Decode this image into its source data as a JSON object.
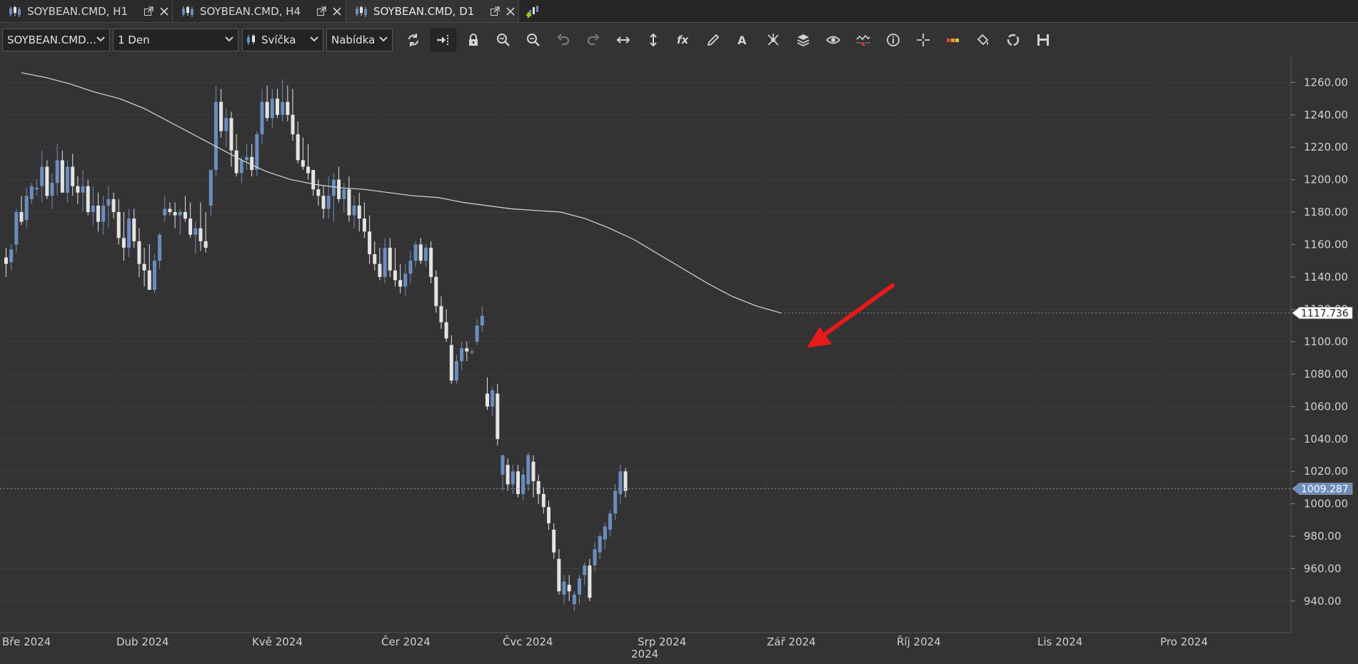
{
  "tabs": [
    {
      "label": "SOYBEAN.CMD, H1",
      "active": false
    },
    {
      "label": "SOYBEAN.CMD, H4",
      "active": false
    },
    {
      "label": "SOYBEAN.CMD, D1",
      "active": true
    }
  ],
  "toolbar": {
    "symbol": "SOYBEAN.CMD...",
    "timeframe": "1 Den",
    "chart_type": "Svíčka",
    "price_side": "Nabídka",
    "icons": [
      "refresh-icon",
      "autoscroll-icon",
      "lock-icon",
      "zoom-in-icon",
      "zoom-out-icon",
      "undo-icon",
      "redo-icon",
      "horizontal-scale-icon",
      "vertical-scale-icon",
      "indicators-fx-icon",
      "draw-pencil-icon",
      "text-tool-icon",
      "hub-icon",
      "layers-icon",
      "eye-icon",
      "signal-icon",
      "info-icon",
      "crosshair-icon",
      "color-bar-icon",
      "paint-bucket-icon",
      "sync-icon",
      "save-icon"
    ]
  },
  "chart_data": {
    "type": "candlestick",
    "symbol": "SOYBEAN.CMD",
    "timeframe": "D1",
    "ylim": [
      932,
      1269
    ],
    "y_ticks": [
      "1260.00",
      "1240.00",
      "1220.00",
      "1200.00",
      "1180.00",
      "1160.00",
      "1140.00",
      "1120.00",
      "1100.00",
      "1080.00",
      "1060.00",
      "1040.00",
      "1020.00",
      "1000.00",
      "980.00",
      "960.00",
      "940.00"
    ],
    "x_labels": [
      "Bře 2024",
      "Dub 2024",
      "Kvě 2024",
      "Čer 2024",
      "Čvc 2024",
      "Srp 2024",
      "Zář 2024",
      "Říj 2024",
      "Lis 2024",
      "Pro 2024"
    ],
    "year_label": "2024",
    "price_labels": {
      "moving_average": "1117.736",
      "current_price": "1009.287"
    },
    "colors": {
      "bull": "#6b8dbd",
      "bear": "#e4e4e4",
      "ma": "#d8d8d8",
      "arrow": "#e8191a",
      "current_label": "#6b8dbd"
    },
    "candles": [
      [
        1152,
        1158,
        1140,
        1148
      ],
      [
        1149,
        1160,
        1144,
        1157
      ],
      [
        1160,
        1182,
        1155,
        1180
      ],
      [
        1180,
        1190,
        1172,
        1174
      ],
      [
        1175,
        1195,
        1170,
        1190
      ],
      [
        1188,
        1198,
        1185,
        1196
      ],
      [
        1194,
        1200,
        1190,
        1195
      ],
      [
        1196,
        1218,
        1186,
        1208
      ],
      [
        1208,
        1212,
        1188,
        1190
      ],
      [
        1190,
        1204,
        1182,
        1198
      ],
      [
        1198,
        1222,
        1190,
        1212
      ],
      [
        1212,
        1218,
        1200,
        1192
      ],
      [
        1192,
        1212,
        1186,
        1208
      ],
      [
        1208,
        1216,
        1190,
        1196
      ],
      [
        1196,
        1202,
        1185,
        1192
      ],
      [
        1192,
        1206,
        1180,
        1196
      ],
      [
        1196,
        1200,
        1178,
        1180
      ],
      [
        1180,
        1196,
        1172,
        1184
      ],
      [
        1184,
        1192,
        1168,
        1174
      ],
      [
        1174,
        1190,
        1166,
        1184
      ],
      [
        1184,
        1196,
        1170,
        1188
      ],
      [
        1188,
        1192,
        1176,
        1180
      ],
      [
        1180,
        1188,
        1160,
        1164
      ],
      [
        1164,
        1180,
        1150,
        1158
      ],
      [
        1158,
        1182,
        1152,
        1176
      ],
      [
        1176,
        1182,
        1158,
        1162
      ],
      [
        1162,
        1170,
        1140,
        1148
      ],
      [
        1148,
        1158,
        1134,
        1144
      ],
      [
        1144,
        1160,
        1132,
        1132
      ],
      [
        1132,
        1154,
        1130,
        1150
      ],
      [
        1150,
        1167,
        1145,
        1166
      ],
      [
        1178,
        1190,
        1174,
        1182
      ],
      [
        1182,
        1186,
        1178,
        1180
      ],
      [
        1180,
        1186,
        1170,
        1178
      ],
      [
        1178,
        1182,
        1166,
        1180
      ],
      [
        1180,
        1190,
        1174,
        1176
      ],
      [
        1176,
        1186,
        1164,
        1166
      ],
      [
        1166,
        1174,
        1154,
        1170
      ],
      [
        1170,
        1186,
        1156,
        1162
      ],
      [
        1162,
        1180,
        1155,
        1158
      ],
      [
        1184,
        1206,
        1178,
        1206
      ],
      [
        1206,
        1258,
        1202,
        1248
      ],
      [
        1248,
        1256,
        1226,
        1230
      ],
      [
        1230,
        1244,
        1220,
        1238
      ],
      [
        1238,
        1242,
        1208,
        1218
      ],
      [
        1218,
        1228,
        1202,
        1204
      ],
      [
        1204,
        1214,
        1198,
        1212
      ],
      [
        1212,
        1222,
        1206,
        1214
      ],
      [
        1214,
        1222,
        1202,
        1206
      ],
      [
        1206,
        1230,
        1202,
        1228
      ],
      [
        1228,
        1256,
        1222,
        1248
      ],
      [
        1248,
        1258,
        1236,
        1238
      ],
      [
        1238,
        1256,
        1232,
        1250
      ],
      [
        1250,
        1256,
        1238,
        1240
      ],
      [
        1240,
        1262,
        1236,
        1248
      ],
      [
        1248,
        1258,
        1236,
        1240
      ],
      [
        1240,
        1256,
        1224,
        1228
      ],
      [
        1228,
        1236,
        1210,
        1212
      ],
      [
        1212,
        1226,
        1206,
        1208
      ],
      [
        1208,
        1222,
        1200,
        1204
      ],
      [
        1206,
        1202,
        1190,
        1194
      ],
      [
        1194,
        1200,
        1184,
        1190
      ],
      [
        1190,
        1196,
        1176,
        1182
      ],
      [
        1182,
        1202,
        1176,
        1190
      ],
      [
        1190,
        1204,
        1174,
        1200
      ],
      [
        1200,
        1208,
        1186,
        1188
      ],
      [
        1188,
        1198,
        1180,
        1194
      ],
      [
        1194,
        1202,
        1174,
        1178
      ],
      [
        1178,
        1190,
        1170,
        1184
      ],
      [
        1184,
        1192,
        1168,
        1176
      ],
      [
        1176,
        1186,
        1164,
        1168
      ],
      [
        1168,
        1178,
        1148,
        1154
      ],
      [
        1154,
        1162,
        1144,
        1148
      ],
      [
        1148,
        1158,
        1138,
        1140
      ],
      [
        1140,
        1164,
        1136,
        1158
      ],
      [
        1158,
        1164,
        1140,
        1144
      ],
      [
        1144,
        1158,
        1134,
        1138
      ],
      [
        1138,
        1148,
        1130,
        1134
      ],
      [
        1134,
        1148,
        1128,
        1142
      ],
      [
        1142,
        1156,
        1136,
        1150
      ],
      [
        1150,
        1162,
        1146,
        1160
      ],
      [
        1160,
        1164,
        1148,
        1150
      ],
      [
        1150,
        1160,
        1146,
        1158
      ],
      [
        1158,
        1162,
        1136,
        1140
      ],
      [
        1140,
        1144,
        1118,
        1122
      ],
      [
        1122,
        1128,
        1108,
        1112
      ],
      [
        1112,
        1120,
        1100,
        1102
      ],
      [
        1098,
        1104,
        1074,
        1076
      ],
      [
        1076,
        1092,
        1074,
        1088
      ],
      [
        1088,
        1100,
        1082,
        1096
      ],
      [
        1096,
        1100,
        1088,
        1094
      ],
      [
        1094,
        1096,
        1092,
        1094
      ],
      [
        1100,
        1114,
        1098,
        1110
      ],
      [
        1110,
        1122,
        1106,
        1116
      ],
      [
        1068,
        1078,
        1058,
        1060
      ],
      [
        1060,
        1072,
        1054,
        1070
      ],
      [
        1068,
        1074,
        1036,
        1040
      ],
      [
        1018,
        1030,
        1008,
        1030
      ],
      [
        1024,
        1028,
        1008,
        1012
      ],
      [
        1012,
        1024,
        1006,
        1020
      ],
      [
        1020,
        1024,
        1004,
        1006
      ],
      [
        1006,
        1022,
        1002,
        1018
      ],
      [
        1012,
        1032,
        1008,
        1030
      ],
      [
        1026,
        1030,
        1004,
        1014
      ],
      [
        1014,
        1018,
        1000,
        1006
      ],
      [
        1006,
        1010,
        994,
        998
      ],
      [
        998,
        1002,
        984,
        988
      ],
      [
        984,
        988,
        966,
        970
      ],
      [
        966,
        972,
        944,
        946
      ],
      [
        944,
        956,
        938,
        952
      ],
      [
        950,
        956,
        940,
        946
      ],
      [
        938,
        946,
        934,
        944
      ],
      [
        944,
        956,
        938,
        954
      ],
      [
        956,
        964,
        950,
        962
      ],
      [
        962,
        966,
        940,
        942
      ],
      [
        962,
        976,
        958,
        972
      ],
      [
        970,
        982,
        966,
        980
      ],
      [
        978,
        988,
        972,
        986
      ],
      [
        984,
        996,
        980,
        994
      ],
      [
        994,
        1012,
        990,
        1008
      ],
      [
        1006,
        1024,
        1000,
        1020
      ],
      [
        1020,
        1022,
        1004,
        1008
      ]
    ],
    "moving_average": [
      1266,
      1263,
      1259,
      1254,
      1250,
      1244,
      1236,
      1228,
      1220,
      1212,
      1205,
      1200,
      1197,
      1195,
      1194,
      1192,
      1190,
      1189,
      1186,
      1184,
      1182,
      1181,
      1180,
      1176,
      1170,
      1163,
      1154,
      1145,
      1136,
      1128,
      1122,
      1117.736
    ]
  }
}
